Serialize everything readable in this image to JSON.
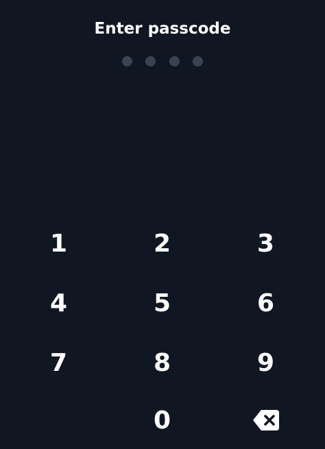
{
  "title": "Enter passcode",
  "passcode": {
    "length": 4,
    "entered": 0
  },
  "keypad": {
    "keys": [
      "1",
      "2",
      "3",
      "4",
      "5",
      "6",
      "7",
      "8",
      "9",
      "0"
    ],
    "backspace_icon": "backspace-icon"
  },
  "colors": {
    "background": "#111722",
    "text": "#ffffff",
    "dot_empty": "#3a4352"
  }
}
